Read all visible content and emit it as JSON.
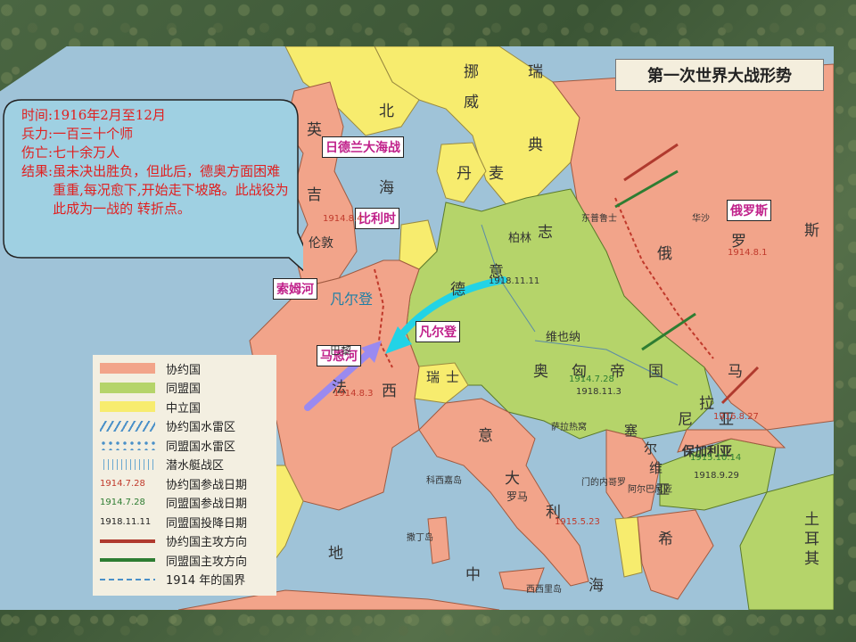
{
  "title": "第一次世界大战形势",
  "callout": {
    "time_key": "时间:",
    "time_val": "1916年2月至12月",
    "force_key": "兵力:",
    "force_val": "一百三十个师",
    "casualty_key": "伤亡:",
    "casualty_val": "七十余万人",
    "result_key": "结果:",
    "result_val": "虽未决出胜负，但此后，德奥方面困难重重,每况愈下,开始走下坡路。此战役为此成为一战的 转折点。"
  },
  "labels": {
    "jutland": "日德兰大海战",
    "belgium": "比利时",
    "somme": "索姆河",
    "verdun": "凡尔登",
    "marne": "马恩河",
    "russia": "俄罗斯",
    "verdun_overlay": "凡尔登"
  },
  "map_text": {
    "norway1": "挪",
    "norway2": "威",
    "sweden1": "瑞",
    "sweden2": "典",
    "north": "北",
    "sea": "海",
    "denmark1": "丹",
    "denmark2": "麦",
    "england1": "英",
    "england2": "吉",
    "london": "伦敦",
    "berlin": "柏林",
    "zhi": "志",
    "yi": "意",
    "de": "德",
    "e": "俄",
    "luo": "罗",
    "si": "斯",
    "vienna": "维也纳",
    "austria": "奥",
    "hungary": "匈",
    "empire": "帝",
    "country": "国",
    "swiss1": "瑞",
    "swiss2": "士",
    "fa": "法",
    "xi": "西",
    "paris": "巴黎",
    "italy_yi": "意",
    "italy_da": "大",
    "italy_li": "利",
    "rome": "罗马",
    "med_di": "地",
    "med_zhong": "中",
    "med_hai": "海",
    "serbia1": "塞",
    "serbia2": "尔",
    "serbia3": "维",
    "serbia4": "亚",
    "bulgaria": "保加利亚",
    "turkey1": "土",
    "turkey2": "耳",
    "turkey3": "其",
    "greece": "希",
    "romania_ma": "马",
    "romania_ni": "尼",
    "romania_ya": "亚",
    "la": "拉",
    "d_1914_8_4": "1914.8.4",
    "d_1914_8_1": "1914.8.1",
    "d_1914_8_3": "1914.8.3",
    "d_1918_11_11": "1918.11.11",
    "d_1914_7_28": "1914.7.28",
    "d_1918_11_3": "1918.11.3",
    "d_1916_8_27": "1916.8.27",
    "d_1915_10_14": "1915.10.14",
    "d_1918_9_29": "1918.9.29",
    "d_1915_5_23": "1915.5.23",
    "d_1915_10_14b": "1915.10.14",
    "sarajevo": "萨拉热窝",
    "east_prussia": "东普鲁士",
    "warsaw": "华沙",
    "corsica": "科西嘉岛",
    "sardinia": "撒丁岛",
    "sicily": "西西里岛",
    "albania": "阿尔巴尼亚",
    "montenegro": "门的内哥罗"
  },
  "legend": [
    {
      "label": "协约国",
      "kind": "entente"
    },
    {
      "label": "同盟国",
      "kind": "central"
    },
    {
      "label": "中立国",
      "kind": "neutral"
    },
    {
      "label": "协约国水雷区",
      "kind": "entente-mines"
    },
    {
      "label": "同盟国水雷区",
      "kind": "central-mines"
    },
    {
      "label": "潜水艇战区",
      "kind": "sub-zone"
    },
    {
      "label": "协约国参战日期",
      "kind": "entente-date",
      "sample": "1914.7.28"
    },
    {
      "label": "同盟国参战日期",
      "kind": "central-date",
      "sample": "1914.7.28"
    },
    {
      "label": "同盟国投降日期",
      "kind": "surrender-date",
      "sample": "1918.11.11"
    },
    {
      "label": "协约国主攻方向",
      "kind": "entente-arrow"
    },
    {
      "label": "同盟国主攻方向",
      "kind": "central-arrow"
    },
    {
      "label": "1914 年的国界",
      "kind": "border-1914"
    }
  ],
  "colors": {
    "entente": "#f2a48a",
    "central": "#b5d46a",
    "neutral": "#f7ec6e",
    "sea": "#9fc3d8",
    "callout_fill": "#9fd0e2",
    "callout_text": "#e02020",
    "label_text": "#c0208a",
    "arrow_cyan": "#22d3e6",
    "arrow_purple": "#9a8af0"
  }
}
